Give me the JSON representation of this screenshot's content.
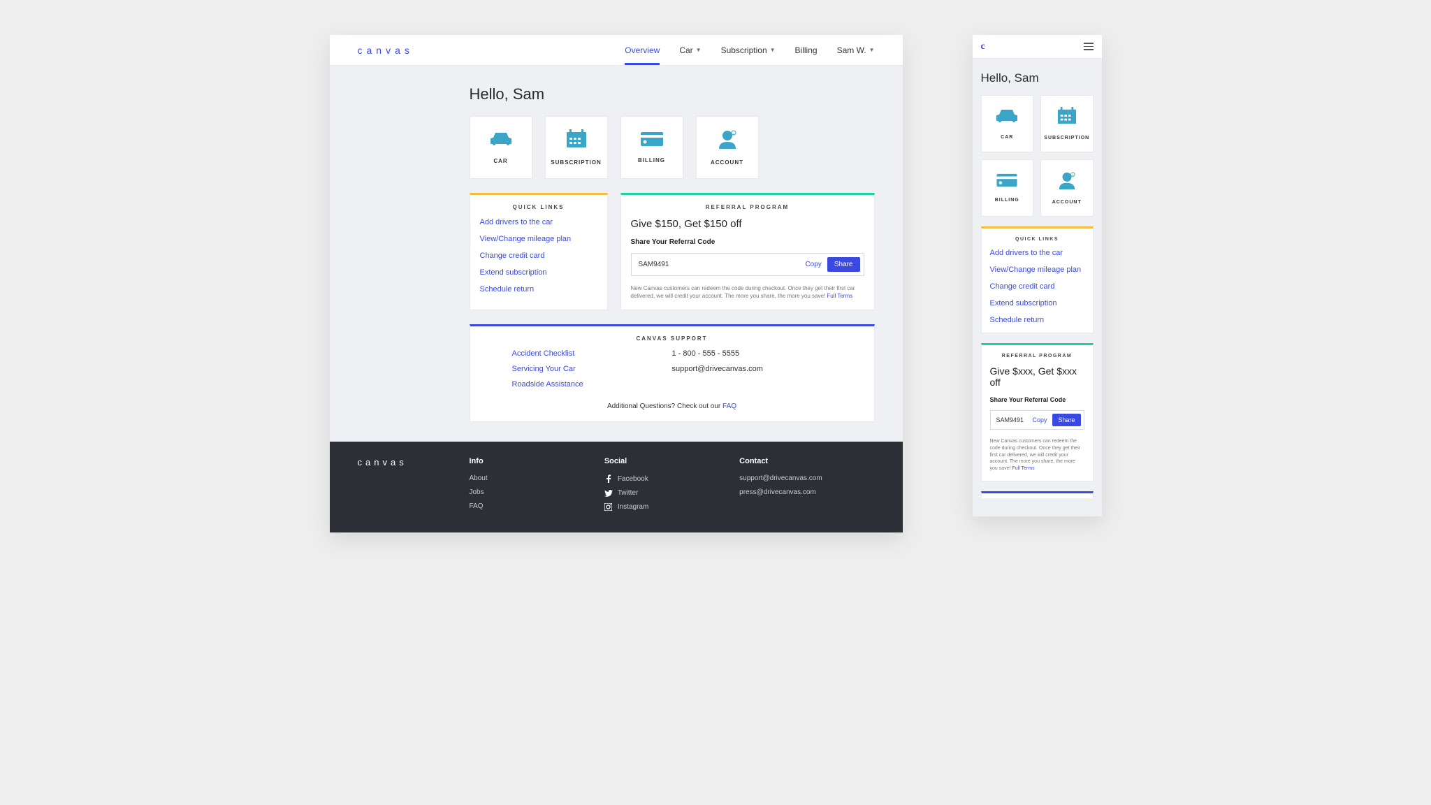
{
  "logo_text": "canvas",
  "mobile_logo": "c",
  "nav": {
    "overview": "Overview",
    "car": "Car",
    "subscription": "Subscription",
    "billing": "Billing",
    "user": "Sam W."
  },
  "greeting": "Hello, Sam",
  "tiles": {
    "car": "CAR",
    "subscription": "SUBSCRIPTION",
    "billing": "BILLING",
    "account": "ACCOUNT"
  },
  "quick_links": {
    "title": "QUICK LINKS",
    "items": [
      "Add drivers to the car",
      "View/Change mileage plan",
      "Change credit card",
      "Extend subscription",
      "Schedule return"
    ]
  },
  "referral": {
    "title": "REFERRAL PROGRAM",
    "headline": "Give $150, Get $150 off",
    "headline_mobile": "Give $xxx, Get $xxx off",
    "share_label": "Share Your Referral Code",
    "code": "SAM9491",
    "copy": "Copy",
    "share": "Share",
    "fine_print": "New Canvas customers can redeem the code during checkout. Once they get their first car delivered, we will credit your account. The more you share, the more you save! ",
    "full_terms": "Full Terms"
  },
  "support": {
    "title": "CANVAS SUPPORT",
    "links": [
      "Accident Checklist",
      "Servicing Your Car",
      "Roadside Assistance"
    ],
    "phone": "1 - 800 - 555 - 5555",
    "email": "support@drivecanvas.com",
    "faq_prefix": "Additional Questions? Check out our ",
    "faq": "FAQ"
  },
  "footer": {
    "info": {
      "head": "Info",
      "items": [
        "About",
        "Jobs",
        "FAQ"
      ]
    },
    "social": {
      "head": "Social",
      "items": [
        "Facebook",
        "Twitter",
        "Instagram"
      ]
    },
    "contact": {
      "head": "Contact",
      "items": [
        "support@drivecanvas.com",
        "press@drivecanvas.com"
      ]
    }
  }
}
